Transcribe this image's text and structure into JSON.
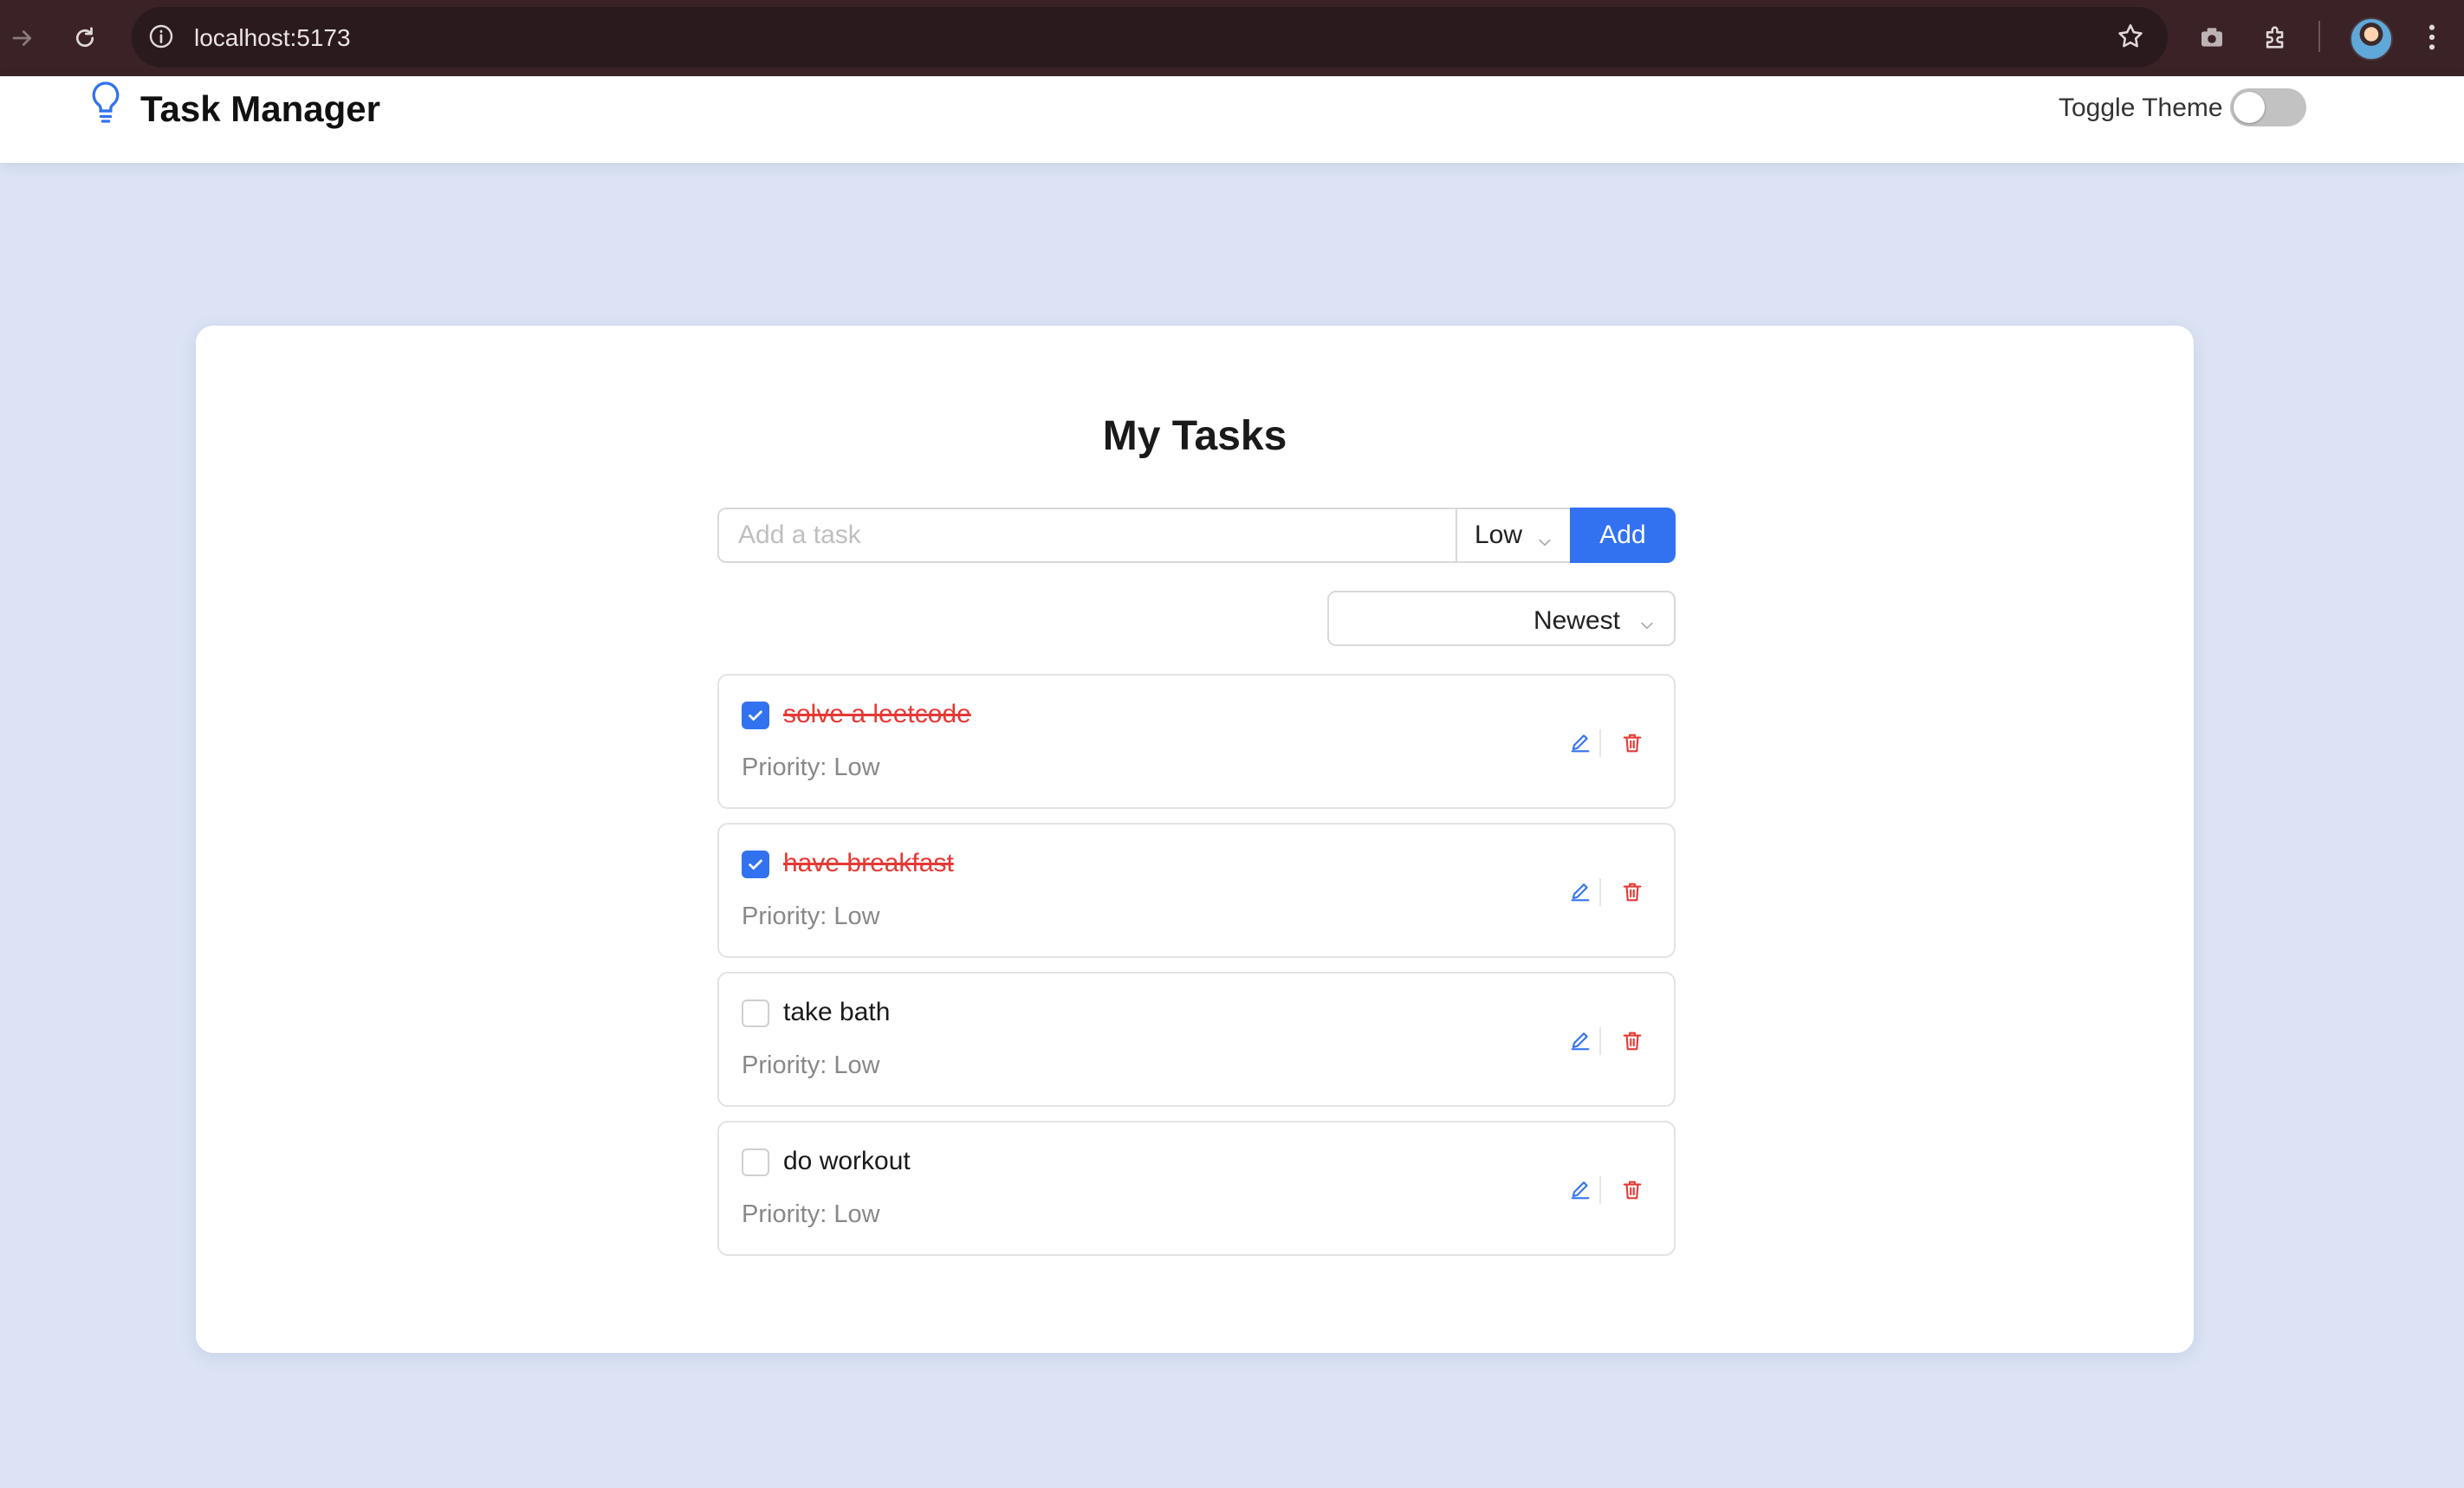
{
  "browser": {
    "url": "localhost:5173",
    "icons": [
      "forward-icon",
      "reload-icon",
      "info-icon",
      "star-icon",
      "camera-icon",
      "extensions-icon",
      "avatar",
      "more-icon"
    ]
  },
  "header": {
    "title": "Task Manager",
    "logo_icon": "lightbulb-icon",
    "theme_label": "Toggle Theme",
    "theme_on": false
  },
  "main": {
    "title": "My Tasks",
    "input_placeholder": "Add a task",
    "input_value": "",
    "priority_value": "Low",
    "add_label": "Add",
    "sort_value": "Newest"
  },
  "tasks": [
    {
      "title": "solve a leetcode",
      "priority": "Priority: Low",
      "done": true
    },
    {
      "title": "have breakfast",
      "priority": "Priority: Low",
      "done": true
    },
    {
      "title": "take bath",
      "priority": "Priority: Low",
      "done": false
    },
    {
      "title": "do workout",
      "priority": "Priority: Low",
      "done": false
    }
  ],
  "colors": {
    "accent": "#3272f1",
    "done_text": "#e53935",
    "delete": "#e53935",
    "edit": "#3272f1",
    "background": "#dbe3f4"
  }
}
